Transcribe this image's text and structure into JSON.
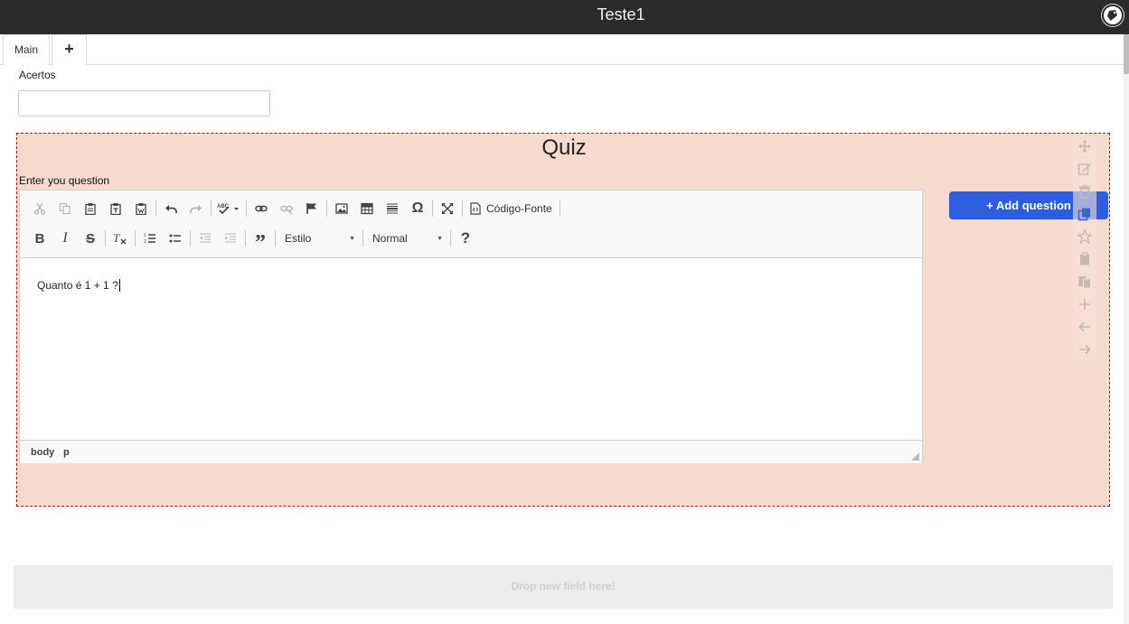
{
  "window": {
    "title": "Teste1"
  },
  "tabs": {
    "main_label": "Main",
    "add_label": "+"
  },
  "form": {
    "acertos_label": "Acertos",
    "acertos_value": ""
  },
  "quiz": {
    "title": "Quiz",
    "question_label": "Enter you question",
    "add_question_label": "+ Add question",
    "editor": {
      "source_label": "Código-Fonte",
      "style_combo": "Estilo",
      "format_combo": "Normal",
      "content": "Quanto é 1 + 1 ?",
      "path": [
        "body",
        "p"
      ]
    }
  },
  "dropzone": {
    "label": "Drop new field here!"
  },
  "colors": {
    "titlebar": "#2b2b2b",
    "quiz_background": "#f7dace",
    "quiz_border": "#a02020",
    "primary_button": "#2b5fe0"
  },
  "icons": {
    "side_actions": [
      "move-icon",
      "edit-icon",
      "delete-icon",
      "copy-icon",
      "star-icon",
      "clipboard-icon",
      "paste-icon",
      "plus-icon",
      "arrow-left-icon",
      "arrow-right-icon"
    ]
  }
}
